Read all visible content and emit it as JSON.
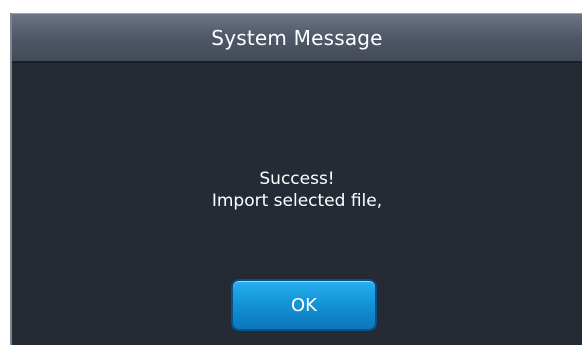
{
  "dialog": {
    "title": "System Message",
    "message_line1": "Success!",
    "message_line2": "Import selected file,",
    "ok_label": "OK"
  },
  "colors": {
    "background": "#252b35",
    "titlebar": "#4f5866",
    "button": "#1495d8",
    "text": "#ffffff"
  }
}
